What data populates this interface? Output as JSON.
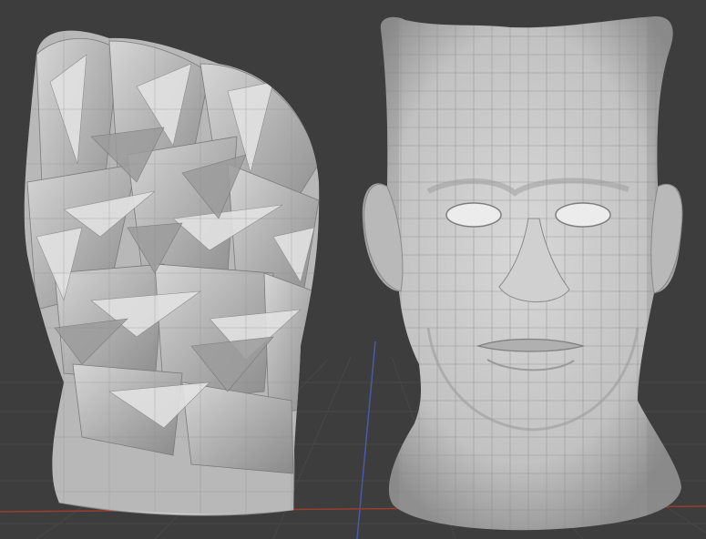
{
  "viewport": {
    "background": "#3d3d3d",
    "grid_color": "#474747",
    "x_axis_color": "#9a3d2c",
    "y_axis_color": "#4a5aa8"
  },
  "objects": [
    {
      "name": "fragmented-head-mesh",
      "shading": "solid-with-wireframe",
      "state": "corrupted geometry"
    },
    {
      "name": "bust-head-mesh",
      "shading": "solid-with-wireframe",
      "state": "clean topology"
    }
  ]
}
